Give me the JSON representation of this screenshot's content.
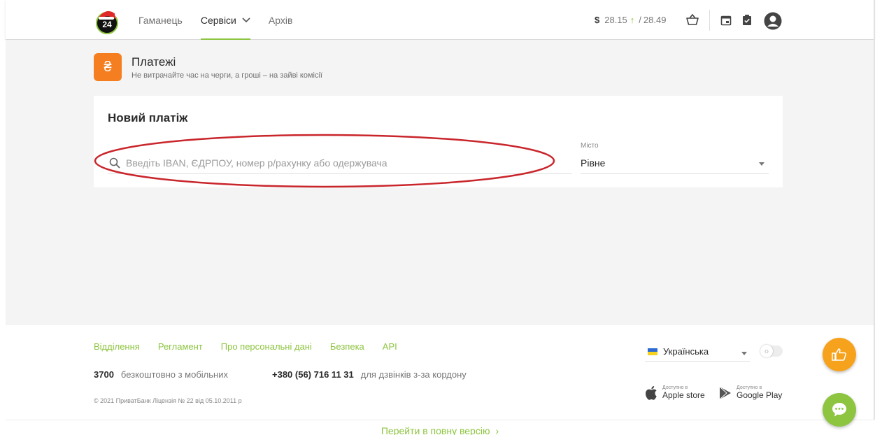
{
  "header": {
    "logo_text": "24",
    "nav": [
      {
        "label": "Гаманець"
      },
      {
        "label": "Сервіси"
      },
      {
        "label": "Архів"
      }
    ],
    "rates": {
      "currency": "$",
      "buy": "28.15",
      "separator": "/",
      "sell": "28.49"
    }
  },
  "payments": {
    "icon_glyph": "₴",
    "title": "Платежі",
    "subtitle": "Не витрачайте час на черги, а гроші – на зайві комісії"
  },
  "new_payment": {
    "title": "Новий платіж",
    "search_placeholder": "Введіть IBAN, ЄДРПОУ, номер р/рахунку або одержувача",
    "city_label": "Місто",
    "city_value": "Рівне"
  },
  "footer": {
    "links": [
      "Відділення",
      "Регламент",
      "Про персональні дані",
      "Безпека",
      "API"
    ],
    "phone_short": "3700",
    "phone_short_note": "безкоштовно з мобільних",
    "phone_intl": "+380 (56) 716 11 31",
    "phone_intl_note": "для дзвінків з-за кордону",
    "copyright": "© 2021 ПриватБанк Ліцензія № 22 від 05.10.2011 р",
    "language": "Українська",
    "apple_small": "Доступно в",
    "apple_big": "Apple store",
    "google_small": "Доступно в",
    "google_big": "Google Play",
    "full_version": "Перейти в повну версію",
    "full_version_arrow": "›"
  },
  "colors": {
    "accent": "#8dc540",
    "payments_icon": "#f57f20",
    "like_button": "#f7a21c",
    "annotation": "#c9262c"
  }
}
